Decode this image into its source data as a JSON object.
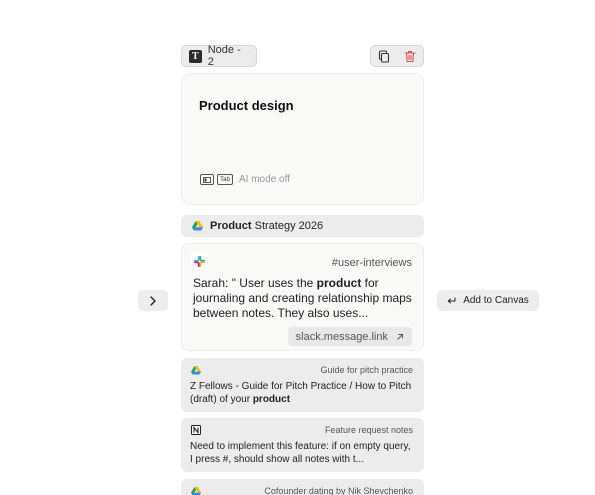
{
  "node": {
    "tag_label": "Node - 2",
    "tag_icon": "text-t-icon",
    "title": "Product design",
    "ai_mode": "AI mode off",
    "kbd_tab": "Tab"
  },
  "strategy": {
    "bold": "Product",
    "rest": " Strategy 2026",
    "icon": "google-drive-icon"
  },
  "slack": {
    "channel": "#user-interviews",
    "pre": "Sarah: \" User uses the ",
    "bold": "product",
    "post": " for journaling and creating relationship maps between notes. They also uses...",
    "link": "slack.message.link"
  },
  "cards": [
    {
      "title": "Guide for pitch practice",
      "pre": "Z Fellows - Guide for Pitch Practice / How to Pitch (draft) of your ",
      "bold": "product",
      "post": "",
      "icon": "google-drive-icon"
    },
    {
      "title": "Feature request notes",
      "pre": "Need to implement this feature: if on empty query, I press #, should show all notes with t...",
      "bold": "",
      "post": "",
      "icon": "notion-icon"
    },
    {
      "title": "Cofounder dating by Nik Shevchenko",
      "icon": "google-drive-icon"
    }
  ],
  "add_to_canvas": "Add to Canvas",
  "colors": {
    "delete": "#e5484d",
    "card_bg": "#f9f9f8",
    "chip_bg": "#ececec"
  }
}
